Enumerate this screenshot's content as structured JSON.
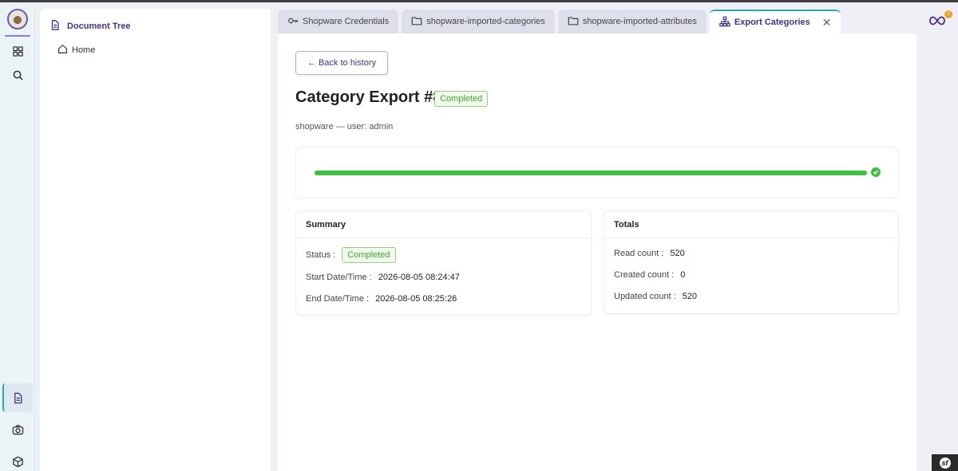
{
  "tree": {
    "title": "Document Tree",
    "home_label": "Home"
  },
  "tabs": [
    {
      "label": "Shopware Credentials",
      "icon": "key-icon"
    },
    {
      "label": "shopware-imported-categories",
      "icon": "folder-icon"
    },
    {
      "label": "shopware-imported-attributes",
      "icon": "folder-icon"
    },
    {
      "label": "Export Categories",
      "icon": "sitemap-icon",
      "active": true
    }
  ],
  "header": {
    "notification_badge": "!"
  },
  "main": {
    "back_label": "← Back to history",
    "title": "Category Export #8",
    "status_badge": "Completed",
    "subtitle": "shopware — user: admin",
    "progress_fraction": 1.0
  },
  "summary": {
    "heading": "Summary",
    "status_label": "Status :",
    "status_value": "Completed",
    "start_label": "Start Date/Time :",
    "start_value": "2026-08-05 08:24:47",
    "end_label": "End Date/Time :",
    "end_value": "2026-08-05 08:25:26"
  },
  "totals": {
    "heading": "Totals",
    "read_label": "Read count :",
    "read_value": "520",
    "created_label": "Created count :",
    "created_value": "0",
    "updated_label": "Updated count :",
    "updated_value": "520"
  },
  "colors": {
    "accent": "#4a2f8e",
    "teal": "#2aa9b7",
    "success": "#3fbf3f"
  }
}
